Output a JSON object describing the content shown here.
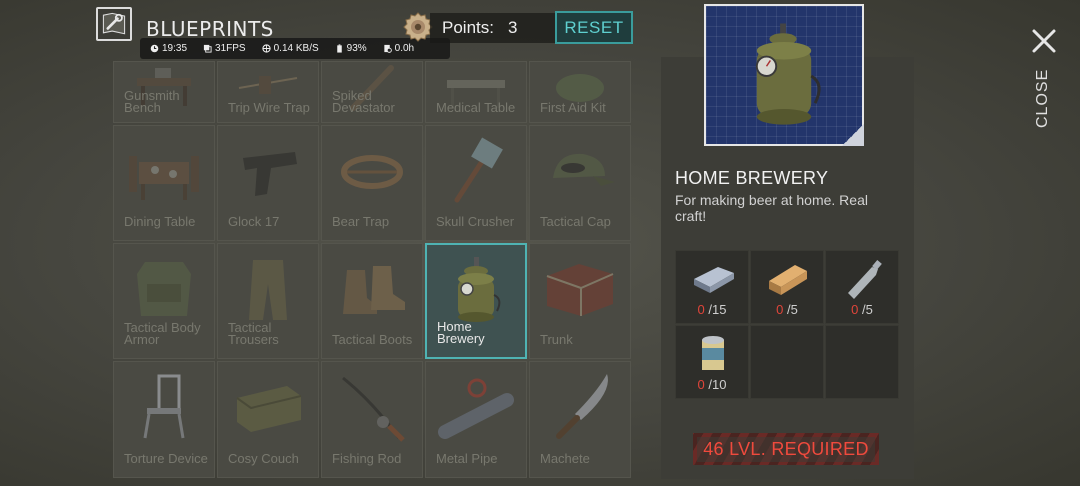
{
  "header": {
    "title": "BLUEPRINTS",
    "icon": "blueprint-wrench-icon",
    "points_label": "Points:",
    "points_value": "3",
    "reset_label": "RESET"
  },
  "status_bar": {
    "time": "19:35",
    "fps": "31FPS",
    "network": "0.14 KB/S",
    "battery": "93%",
    "session": "0.0h"
  },
  "grid": {
    "items": [
      {
        "label": "Gunsmith Bench",
        "icon": "gunsmith-bench-icon"
      },
      {
        "label": "Trip Wire Trap",
        "icon": "trip-wire-icon"
      },
      {
        "label": "Spiked Devastator",
        "icon": "spiked-bat-icon"
      },
      {
        "label": "Medical Table",
        "icon": "medical-table-icon"
      },
      {
        "label": "First Aid Kit",
        "icon": "first-aid-kit-icon"
      },
      {
        "label": "Dining Table",
        "icon": "dining-table-icon"
      },
      {
        "label": "Glock 17",
        "icon": "pistol-icon"
      },
      {
        "label": "Bear Trap",
        "icon": "bear-trap-icon"
      },
      {
        "label": "Skull Crusher",
        "icon": "hammer-icon"
      },
      {
        "label": "Tactical Cap",
        "icon": "cap-icon"
      },
      {
        "label": "Tactical Body Armor",
        "icon": "body-armor-icon"
      },
      {
        "label": "Tactical Trousers",
        "icon": "trousers-icon"
      },
      {
        "label": "Tactical Boots",
        "icon": "boots-icon"
      },
      {
        "label": "Home Brewery",
        "icon": "brewery-icon",
        "selected": true
      },
      {
        "label": "Trunk",
        "icon": "trunk-icon"
      },
      {
        "label": "Torture Device",
        "icon": "torture-chair-icon"
      },
      {
        "label": "Cosy Couch",
        "icon": "couch-icon"
      },
      {
        "label": "Fishing Rod",
        "icon": "fishing-rod-icon"
      },
      {
        "label": "Metal Pipe",
        "icon": "metal-pipe-icon"
      },
      {
        "label": "Machete",
        "icon": "machete-icon"
      }
    ]
  },
  "detail": {
    "name": "HOME BREWERY",
    "description": "For making beer at home. Real craft!",
    "image_icon": "brewery-blueprint-icon",
    "resources": [
      {
        "icon": "iron-bar-icon",
        "have": "0",
        "need": "/15"
      },
      {
        "icon": "wood-plank-icon",
        "have": "0",
        "need": "/5"
      },
      {
        "icon": "plastic-bottle-icon",
        "have": "0",
        "need": "/5"
      },
      {
        "icon": "tin-can-icon",
        "have": "0",
        "need": "/10"
      }
    ],
    "requirement": "46 LVL. REQUIRED"
  },
  "close": {
    "label": "CLOSE",
    "icon": "close-icon"
  },
  "colors": {
    "accent": "#3a9c9c",
    "missing_resource": "#e0453a",
    "requirement": "#f04a3d",
    "blueprint": "#23356b"
  }
}
